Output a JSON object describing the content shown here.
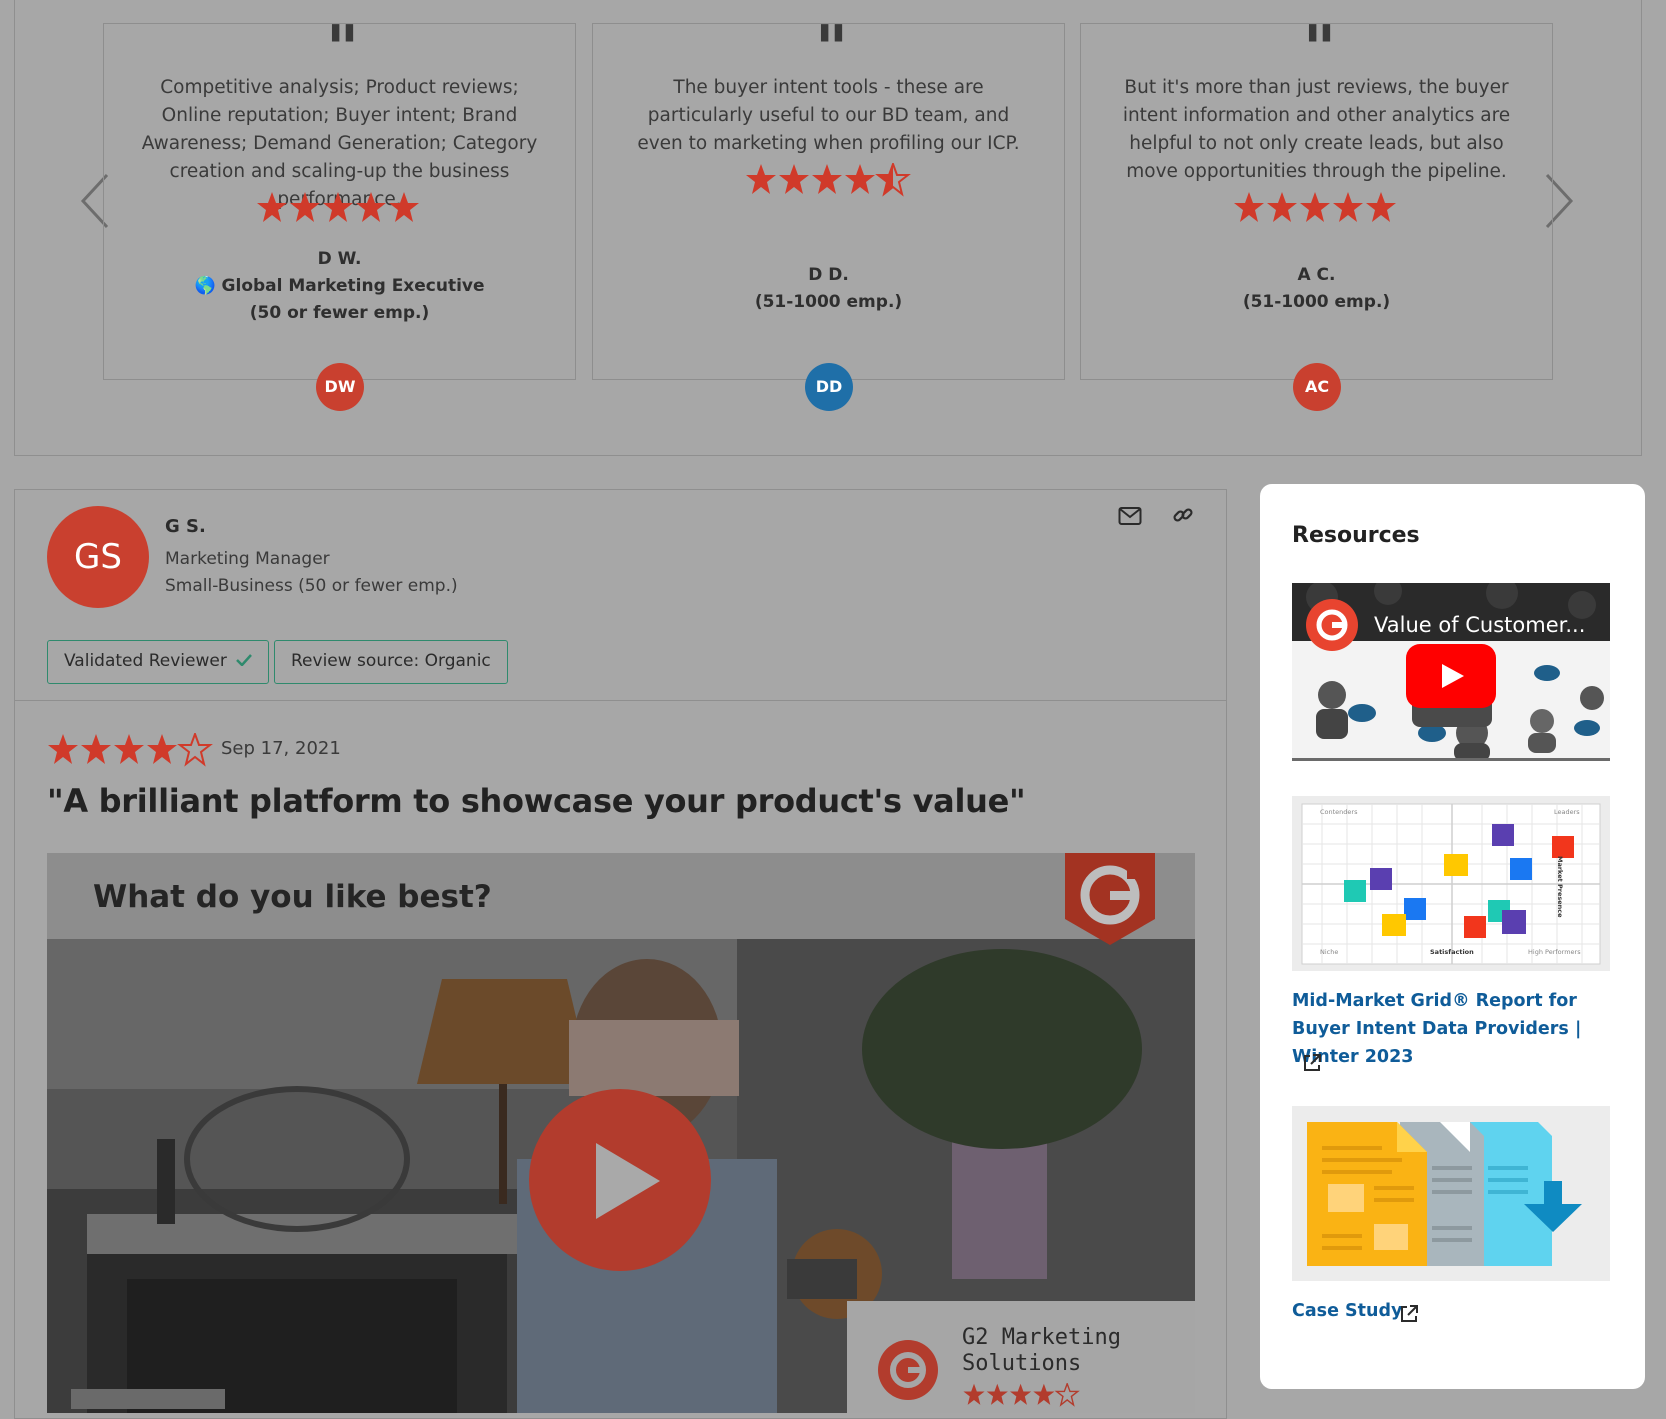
{
  "testimonials": [
    {
      "quote": "Competitive analysis; Product reviews; Online reputation; Buyer intent; Brand Awareness; Demand Generation; Category creation and scaling-up the business performance.",
      "rating": 5,
      "name": "D W.",
      "role": "Global Marketing Executive",
      "role_icon": "globe-emoji",
      "company_size": "(50 or fewer emp.)",
      "initials": "DW",
      "avatar_color": "#c9402f"
    },
    {
      "quote": "The buyer intent tools - these are particularly useful to our BD team, and even to marketing when profiling our ICP.",
      "rating": 4.5,
      "name": "D D.",
      "company_size": "(51-1000 emp.)",
      "initials": "DD",
      "avatar_color": "#1f6fa8"
    },
    {
      "quote": "But it's more than just reviews, the buyer intent information and other analytics are helpful to not only create leads, but also move opportunities through the pipeline.",
      "rating": 5,
      "name": "A C.",
      "company_size": "(51-1000 emp.)",
      "initials": "AC",
      "avatar_color": "#c9402f"
    }
  ],
  "review": {
    "initials": "GS",
    "reviewer_name": "G S.",
    "job_title": "Marketing Manager",
    "segment": "Small-Business (50 or fewer emp.)",
    "badge_validated": "Validated Reviewer",
    "badge_source": "Review source: Organic",
    "rating": 4,
    "date": "Sep 17, 2021",
    "title": "\"A brilliant platform to showcase your product's value\"",
    "video": {
      "question": "What do you like best?",
      "lower_third": "G2 Marketing Solutions"
    }
  },
  "resources": {
    "heading": "Resources",
    "video_title": "Value of Customer...",
    "items": [
      {
        "label": "Mid-Market Grid® Report for Buyer Intent Data Providers | Winter 2023"
      },
      {
        "label": "Case Study"
      }
    ],
    "grid_labels": {
      "top_left": "Contenders",
      "top_right": "Leaders",
      "bottom_left": "Niche",
      "bottom_center": "Satisfaction",
      "bottom_right": "High Performers",
      "right_axis": "Market Presence"
    }
  },
  "colors": {
    "star_red": "#d03a2a",
    "brand_red": "#c9402f",
    "link_blue": "#0f5c99",
    "badge_green": "#2f8a6d",
    "overlay_gray": "#a7a7a7"
  }
}
